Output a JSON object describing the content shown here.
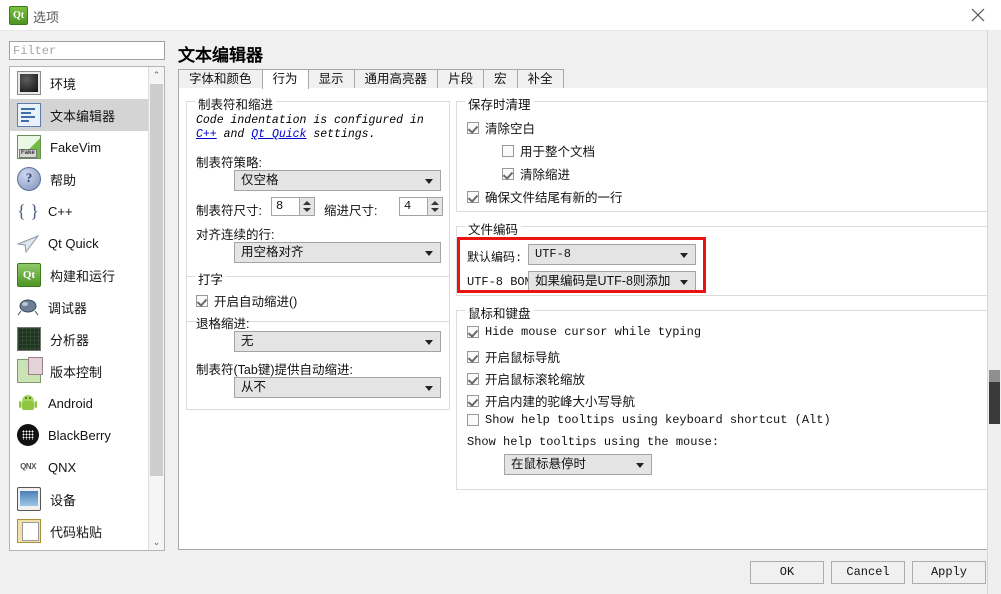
{
  "window": {
    "title": "选项",
    "app_icon": "qt-logo-icon",
    "close_label": "✕"
  },
  "sidebar": {
    "filter": {
      "placeholder": "Filter",
      "value": ""
    },
    "items": [
      {
        "label": "环境",
        "icon": "environment-icon",
        "selected": false
      },
      {
        "label": "文本编辑器",
        "icon": "text-editor-icon",
        "selected": true
      },
      {
        "label": "FakeVim",
        "icon": "fakevim-icon",
        "selected": false
      },
      {
        "label": "帮助",
        "icon": "help-icon",
        "selected": false
      },
      {
        "label": "C++",
        "icon": "cpp-icon",
        "selected": false
      },
      {
        "label": "Qt Quick",
        "icon": "qt-quick-icon",
        "selected": false
      },
      {
        "label": "构建和运行",
        "icon": "build-and-run-icon",
        "selected": false
      },
      {
        "label": "调试器",
        "icon": "debugger-icon",
        "selected": false
      },
      {
        "label": "分析器",
        "icon": "analyzer-icon",
        "selected": false
      },
      {
        "label": "版本控制",
        "icon": "version-control-icon",
        "selected": false
      },
      {
        "label": "Android",
        "icon": "android-icon",
        "selected": false
      },
      {
        "label": "BlackBerry",
        "icon": "blackberry-icon",
        "selected": false
      },
      {
        "label": "QNX",
        "icon": "qnx-icon",
        "selected": false
      },
      {
        "label": "设备",
        "icon": "devices-icon",
        "selected": false
      },
      {
        "label": "代码粘贴",
        "icon": "code-paster-icon",
        "selected": false
      }
    ],
    "scroll_up": "⌃",
    "scroll_down": "⌄"
  },
  "page": {
    "title": "文本编辑器",
    "tabs": [
      {
        "label": "字体和颜色",
        "active": false
      },
      {
        "label": "行为",
        "active": true
      },
      {
        "label": "显示",
        "active": false
      },
      {
        "label": "通用高亮器",
        "active": false
      },
      {
        "label": "片段",
        "active": false
      },
      {
        "label": "宏",
        "active": false
      },
      {
        "label": "补全",
        "active": false
      }
    ]
  },
  "tabs_and_indentation": {
    "legend": "制表符和缩进",
    "info_prefix": "Code indentation is configured in ",
    "info_link1": "C++",
    "info_middle": " and ",
    "info_link2": "Qt Quick",
    "info_suffix": " settings.",
    "tab_policy_label": "制表符策略:",
    "tab_policy_value": "仅空格",
    "tab_size_label": "制表符尺寸:",
    "tab_size_value": "8",
    "indent_size_label": "缩进尺寸:",
    "indent_size_value": "4",
    "align_continuation_label": "对齐连续的行:",
    "align_continuation_value": "用空格对齐"
  },
  "typing": {
    "legend": "打字",
    "auto_indent": {
      "label": "开启自动缩进()",
      "checked": true
    },
    "backspace_label": "退格缩进:",
    "backspace_value": "无",
    "tab_key_label": "制表符(Tab键)提供自动缩进:",
    "tab_key_value": "从不"
  },
  "cleanup_on_save": {
    "legend": "保存时清理",
    "clean_whitespace": {
      "label": "清除空白",
      "checked": true
    },
    "in_entire_document": {
      "label": "用于整个文档",
      "checked": false
    },
    "clean_indentation": {
      "label": "清除缩进",
      "checked": true
    },
    "ensure_newline": {
      "label": "确保文件结尾有新的一行",
      "checked": true
    }
  },
  "file_encoding": {
    "legend": "文件编码",
    "default_encoding_label": "默认编码:",
    "default_encoding_value": "UTF-8",
    "utf8_bom_label": "UTF-8 BOM:",
    "utf8_bom_value": "如果编码是UTF-8则添加",
    "highlight_color": "#ee1111"
  },
  "mouse_and_keyboard": {
    "legend": "鼠标和键盘",
    "hide_cursor": {
      "label": "Hide mouse cursor while typing",
      "checked": true,
      "mono": true
    },
    "mouse_nav": {
      "label": "开启鼠标导航",
      "checked": true,
      "mono": false
    },
    "wheel_zoom": {
      "label": "开启鼠标滚轮缩放",
      "checked": true,
      "mono": false
    },
    "camel_case_nav": {
      "label": "开启内建的驼峰大小写导航",
      "checked": true,
      "mono": false
    },
    "tooltip_shortcut": {
      "label": "Show help tooltips using keyboard shortcut (Alt)",
      "checked": false,
      "mono": true
    },
    "tooltip_mouse_label": "Show help tooltips using the mouse:",
    "tooltip_mouse_value": "在鼠标悬停时"
  },
  "footer": {
    "ok": "OK",
    "cancel": "Cancel",
    "apply": "Apply"
  }
}
